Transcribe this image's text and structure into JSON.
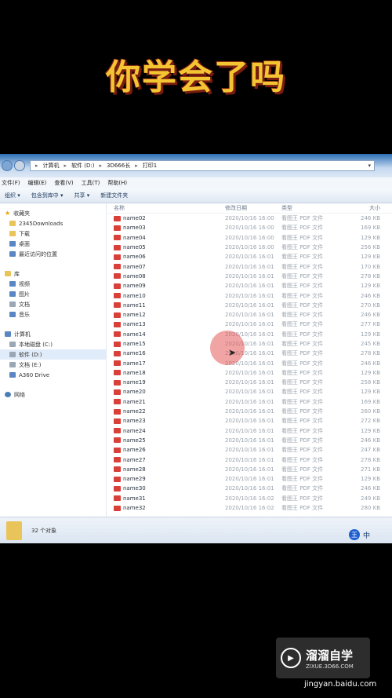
{
  "overlay_title": "你学会了吗",
  "address": {
    "segments": [
      "计算机",
      "软件 (D:)",
      "3D666长",
      "打印1"
    ]
  },
  "menu": [
    "文件(F)",
    "编辑(E)",
    "查看(V)",
    "工具(T)",
    "帮助(H)"
  ],
  "toolbar": [
    "组织 ▾",
    "包含到库中 ▾",
    "共享 ▾",
    "新建文件夹"
  ],
  "nav": {
    "favorites": {
      "label": "收藏夹",
      "items": [
        "2345Downloads",
        "下载",
        "桌面",
        "最近访问的位置"
      ]
    },
    "libraries": {
      "label": "库",
      "items": [
        "视频",
        "图片",
        "文档",
        "音乐"
      ]
    },
    "computer": {
      "label": "计算机",
      "items": [
        "本地磁盘 (C:)",
        "软件 (D:)",
        "文档 (E:)",
        "A360 Drive"
      ]
    },
    "network": {
      "label": "网络"
    }
  },
  "columns": [
    "名称",
    "修改日期",
    "类型",
    "大小"
  ],
  "files": [
    {
      "name": "name02",
      "date": "2020/10/16 16:00",
      "type": "看图王 PDF 文件",
      "size": "246 KB"
    },
    {
      "name": "name03",
      "date": "2020/10/16 16:00",
      "type": "看图王 PDF 文件",
      "size": "169 KB"
    },
    {
      "name": "name04",
      "date": "2020/10/16 16:00",
      "type": "看图王 PDF 文件",
      "size": "129 KB"
    },
    {
      "name": "name05",
      "date": "2020/10/16 16:00",
      "type": "看图王 PDF 文件",
      "size": "256 KB"
    },
    {
      "name": "name06",
      "date": "2020/10/16 16:01",
      "type": "看图王 PDF 文件",
      "size": "129 KB"
    },
    {
      "name": "name07",
      "date": "2020/10/16 16:01",
      "type": "看图王 PDF 文件",
      "size": "170 KB"
    },
    {
      "name": "name08",
      "date": "2020/10/16 16:01",
      "type": "看图王 PDF 文件",
      "size": "278 KB"
    },
    {
      "name": "name09",
      "date": "2020/10/16 16:01",
      "type": "看图王 PDF 文件",
      "size": "129 KB"
    },
    {
      "name": "name10",
      "date": "2020/10/16 16:01",
      "type": "看图王 PDF 文件",
      "size": "246 KB"
    },
    {
      "name": "name11",
      "date": "2020/10/16 16:01",
      "type": "看图王 PDF 文件",
      "size": "270 KB"
    },
    {
      "name": "name12",
      "date": "2020/10/16 16:01",
      "type": "看图王 PDF 文件",
      "size": "246 KB"
    },
    {
      "name": "name13",
      "date": "2020/10/16 16:01",
      "type": "看图王 PDF 文件",
      "size": "277 KB"
    },
    {
      "name": "name14",
      "date": "2020/10/16 16:01",
      "type": "看图王 PDF 文件",
      "size": "129 KB"
    },
    {
      "name": "name15",
      "date": "2020/10/16 16:01",
      "type": "看图王 PDF 文件",
      "size": "245 KB"
    },
    {
      "name": "name16",
      "date": "2020/10/16 16:01",
      "type": "看图王 PDF 文件",
      "size": "278 KB"
    },
    {
      "name": "name17",
      "date": "2020/10/16 16:01",
      "type": "看图王 PDF 文件",
      "size": "246 KB"
    },
    {
      "name": "name18",
      "date": "2020/10/16 16:01",
      "type": "看图王 PDF 文件",
      "size": "129 KB"
    },
    {
      "name": "name19",
      "date": "2020/10/16 16:01",
      "type": "看图王 PDF 文件",
      "size": "258 KB"
    },
    {
      "name": "name20",
      "date": "2020/10/16 16:01",
      "type": "看图王 PDF 文件",
      "size": "129 KB"
    },
    {
      "name": "name21",
      "date": "2020/10/16 16:01",
      "type": "看图王 PDF 文件",
      "size": "169 KB"
    },
    {
      "name": "name22",
      "date": "2020/10/16 16:01",
      "type": "看图王 PDF 文件",
      "size": "260 KB"
    },
    {
      "name": "name23",
      "date": "2020/10/16 16:01",
      "type": "看图王 PDF 文件",
      "size": "272 KB"
    },
    {
      "name": "name24",
      "date": "2020/10/16 16:01",
      "type": "看图王 PDF 文件",
      "size": "129 KB"
    },
    {
      "name": "name25",
      "date": "2020/10/16 16:01",
      "type": "看图王 PDF 文件",
      "size": "246 KB"
    },
    {
      "name": "name26",
      "date": "2020/10/16 16:01",
      "type": "看图王 PDF 文件",
      "size": "247 KB"
    },
    {
      "name": "name27",
      "date": "2020/10/16 16:01",
      "type": "看图王 PDF 文件",
      "size": "278 KB"
    },
    {
      "name": "name28",
      "date": "2020/10/16 16:01",
      "type": "看图王 PDF 文件",
      "size": "271 KB"
    },
    {
      "name": "name29",
      "date": "2020/10/16 16:01",
      "type": "看图王 PDF 文件",
      "size": "129 KB"
    },
    {
      "name": "name30",
      "date": "2020/10/16 16:01",
      "type": "看图王 PDF 文件",
      "size": "246 KB"
    },
    {
      "name": "name31",
      "date": "2020/10/16 16:02",
      "type": "看图王 PDF 文件",
      "size": "249 KB"
    },
    {
      "name": "name32",
      "date": "2020/10/16 16:02",
      "type": "看图王 PDF 文件",
      "size": "280 KB"
    }
  ],
  "status": "32 个对象",
  "tray": {
    "badge": "王",
    "ime": "中"
  },
  "watermark": {
    "title": "溜溜自学",
    "subtitle": "ZIXUE.3D66.COM",
    "credit": "jingyan.baidu.com"
  }
}
